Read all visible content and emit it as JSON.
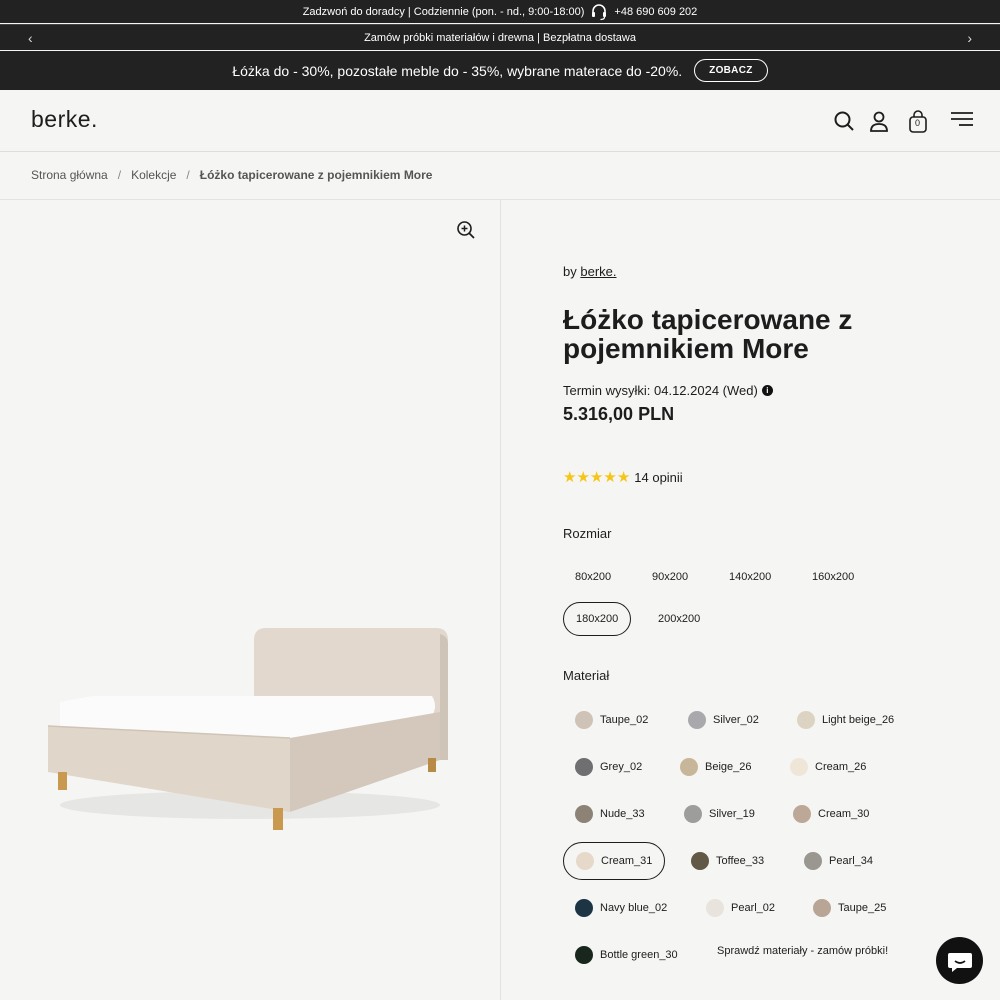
{
  "top_bar": {
    "text": "Zadzwoń do doradcy | Codziennie (pon. - nd., 9:00-18:00)",
    "phone": "+48 690 609 202"
  },
  "announcement": {
    "text": "Zamów próbki materiałów i drewna | Bezpłatna dostawa"
  },
  "promo": {
    "text": "Łóżka do - 30%, pozostałe meble do - 35%, wybrane materace do -20%.",
    "button": "ZOBACZ"
  },
  "header": {
    "logo": "berke.",
    "cart_count": "0"
  },
  "breadcrumb": [
    "Strona główna",
    "Kolekcje",
    "Łóżko tapicerowane z pojemnikiem More"
  ],
  "breadcrumb_sep": "/",
  "product": {
    "by_prefix": "by",
    "brand": "berke.",
    "title": "Łóżko tapicerowane z pojemnikiem More",
    "shipping": "Termin wysyłki: 04.12.2024 (Wed)",
    "price": "5.316,00 PLN",
    "rating": 5,
    "reviews": "14 opinii"
  },
  "size": {
    "label": "Rozmiar",
    "options": [
      "80x200",
      "90x200",
      "140x200",
      "160x200",
      "180x200",
      "200x200"
    ],
    "selected": "180x200"
  },
  "material": {
    "label": "Materiał",
    "options": [
      {
        "name": "Taupe_02",
        "color": "#cfc3b8"
      },
      {
        "name": "Silver_02",
        "color": "#a9a9ad"
      },
      {
        "name": "Light beige_26",
        "color": "#dcd3c2"
      },
      {
        "name": "Grey_02",
        "color": "#6f6f72"
      },
      {
        "name": "Beige_26",
        "color": "#c8b69a"
      },
      {
        "name": "Cream_26",
        "color": "#efe6d8"
      },
      {
        "name": "Nude_33",
        "color": "#8c8276"
      },
      {
        "name": "Silver_19",
        "color": "#9d9d9b"
      },
      {
        "name": "Cream_30",
        "color": "#bda898"
      },
      {
        "name": "Cream_31",
        "color": "#e6d9c9"
      },
      {
        "name": "Toffee_33",
        "color": "#615845"
      },
      {
        "name": "Pearl_34",
        "color": "#9a9790"
      },
      {
        "name": "Navy blue_02",
        "color": "#1d3444"
      },
      {
        "name": "Pearl_02",
        "color": "#e8e3dc"
      },
      {
        "name": "Taupe_25",
        "color": "#b9a595"
      },
      {
        "name": "Bottle green_30",
        "color": "#18261e"
      }
    ],
    "selected": "Cream_31",
    "samples_link": "Sprawdź materiały - zamów próbki!"
  }
}
